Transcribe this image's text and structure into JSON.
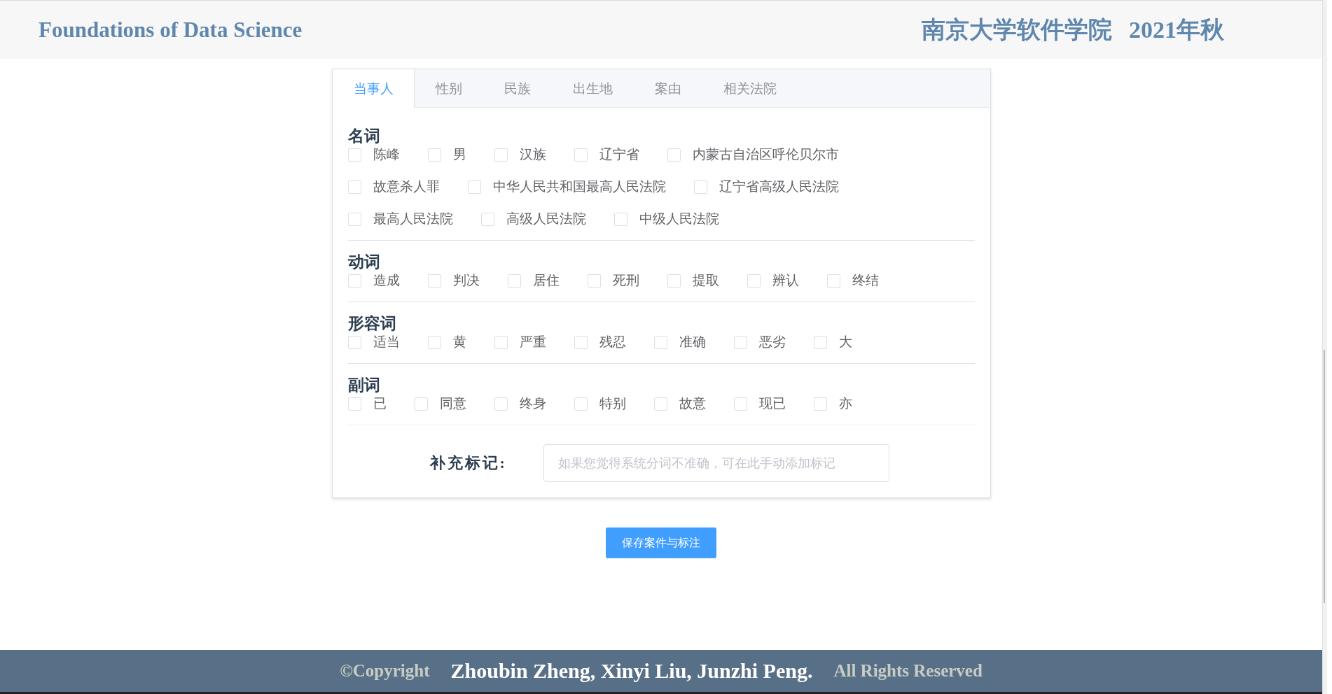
{
  "header": {
    "title": "Foundations of Data Science",
    "school": "南京大学软件学院",
    "term": "2021年秋"
  },
  "tabs": [
    {
      "label": "当事人",
      "selected": true
    },
    {
      "label": "性别",
      "selected": false
    },
    {
      "label": "民族",
      "selected": false
    },
    {
      "label": "出生地",
      "selected": false
    },
    {
      "label": "案由",
      "selected": false
    },
    {
      "label": "相关法院",
      "selected": false
    }
  ],
  "sections": [
    {
      "title": "名词",
      "options": [
        {
          "label": "陈峰",
          "checked": false
        },
        {
          "label": "男",
          "checked": false
        },
        {
          "label": "汉族",
          "checked": false
        },
        {
          "label": "辽宁省",
          "checked": false
        },
        {
          "label": "内蒙古自治区呼伦贝尔市",
          "checked": false
        },
        {
          "label": "故意杀人罪",
          "checked": false
        },
        {
          "label": "中华人民共和国最高人民法院",
          "checked": false
        },
        {
          "label": "辽宁省高级人民法院",
          "checked": false
        },
        {
          "label": "最高人民法院",
          "checked": false
        },
        {
          "label": "高级人民法院",
          "checked": false
        },
        {
          "label": "中级人民法院",
          "checked": false
        }
      ]
    },
    {
      "title": "动词",
      "options": [
        {
          "label": "造成",
          "checked": false
        },
        {
          "label": "判决",
          "checked": false
        },
        {
          "label": "居住",
          "checked": false
        },
        {
          "label": "死刑",
          "checked": false
        },
        {
          "label": "提取",
          "checked": false
        },
        {
          "label": "辨认",
          "checked": false
        },
        {
          "label": "终结",
          "checked": false
        }
      ]
    },
    {
      "title": "形容词",
      "options": [
        {
          "label": "适当",
          "checked": false
        },
        {
          "label": "黄",
          "checked": false
        },
        {
          "label": "严重",
          "checked": false
        },
        {
          "label": "残忍",
          "checked": false
        },
        {
          "label": "准确",
          "checked": false
        },
        {
          "label": "恶劣",
          "checked": false
        },
        {
          "label": "大",
          "checked": false
        }
      ]
    },
    {
      "title": "副词",
      "options": [
        {
          "label": "已",
          "checked": false
        },
        {
          "label": "同意",
          "checked": false
        },
        {
          "label": "终身",
          "checked": false
        },
        {
          "label": "特别",
          "checked": false
        },
        {
          "label": "故意",
          "checked": false
        },
        {
          "label": "现已",
          "checked": false
        },
        {
          "label": "亦",
          "checked": false
        }
      ]
    }
  ],
  "note": {
    "label": "补充标记:",
    "placeholder": "如果您觉得系统分词不准确，可在此手动添加标记"
  },
  "save_button": "保存案件与标注",
  "footer": {
    "copyright": "©Copyright",
    "authors": "Zhoubin Zheng, Xinyi Liu, Junzhi Peng.",
    "rights": "All Rights Reserved"
  }
}
